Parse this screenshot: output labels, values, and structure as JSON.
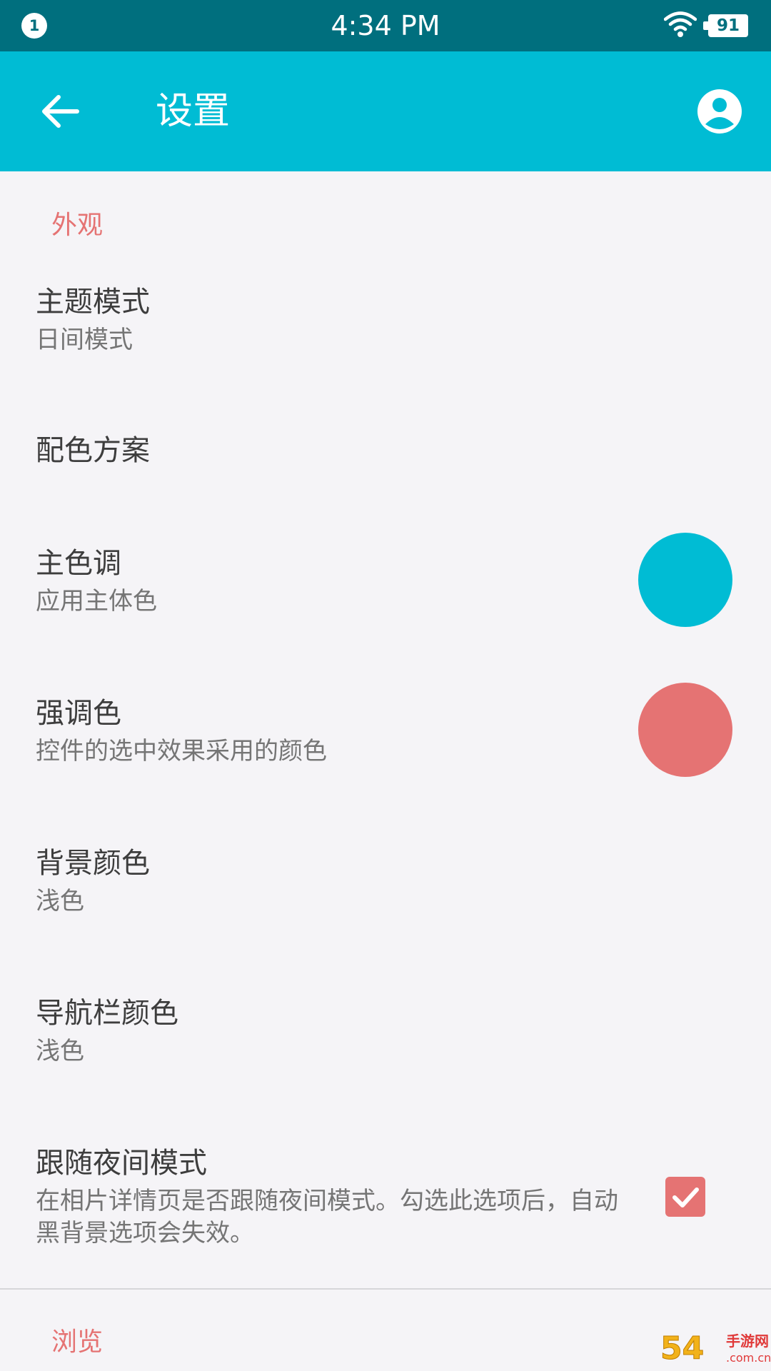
{
  "status_bar": {
    "notification_count": "1",
    "time": "4:34 PM",
    "battery_level": "91",
    "icons": [
      "wifi-icon",
      "battery-icon"
    ]
  },
  "app_bar": {
    "title": "设置",
    "back_icon": "arrow-back-icon",
    "account_icon": "account-circle-icon",
    "background_color": "#00bcd4"
  },
  "sections": [
    {
      "header": "外观",
      "items": [
        {
          "title": "主题模式",
          "summary": "日间模式"
        },
        {
          "title": "配色方案"
        },
        {
          "title": "主色调",
          "summary": "应用主体色",
          "swatch_color": "#00bcd4"
        },
        {
          "title": "强调色",
          "summary": "控件的选中效果采用的颜色",
          "swatch_color": "#e57373"
        },
        {
          "title": "背景颜色",
          "summary": "浅色"
        },
        {
          "title": "导航栏颜色",
          "summary": "浅色"
        },
        {
          "title": "跟随夜间模式",
          "summary": "在相片详情页是否跟随夜间模式。勾选此选项后，自动黑背景选项会失效。",
          "checked": true
        }
      ]
    },
    {
      "header": "浏览"
    }
  ],
  "colors": {
    "status_bar": "#006f7e",
    "accent": "#e57373",
    "primary": "#00bcd4",
    "background": "#f5f4f7"
  },
  "watermark": {
    "digits": "54",
    "brand": "手游网",
    "domain": ".com.cn"
  }
}
